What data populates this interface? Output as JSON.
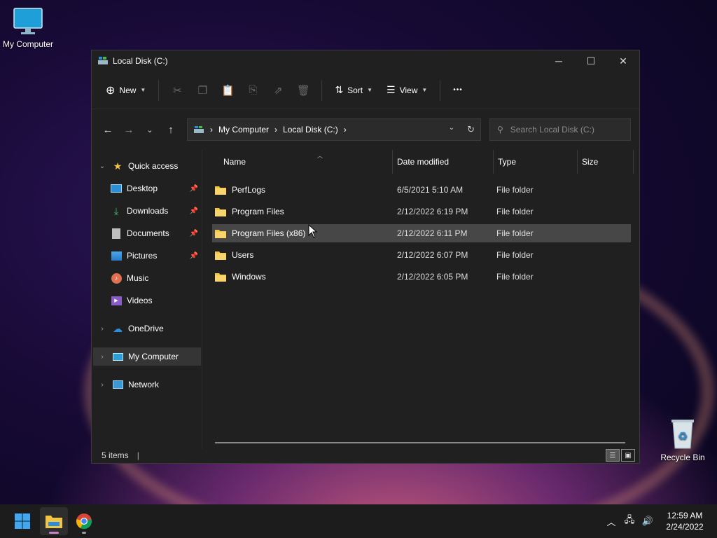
{
  "desktop": {
    "icons": [
      {
        "label": "My Computer"
      },
      {
        "label": "Recycle Bin"
      }
    ]
  },
  "window": {
    "title": "Local Disk (C:)",
    "controls": {
      "minimize": "─",
      "maximize": "☐",
      "close": "✕"
    }
  },
  "toolbar": {
    "new_label": "New",
    "sort_label": "Sort",
    "view_label": "View",
    "more_label": "•••",
    "disabled_icons": [
      "cut-icon",
      "copy-icon",
      "paste-icon",
      "rename-icon",
      "share-icon",
      "delete-icon"
    ]
  },
  "address": {
    "crumbs": [
      "My Computer",
      "Local Disk (C:)"
    ],
    "search_placeholder": "Search Local Disk (C:)"
  },
  "navpane": {
    "quick_access": "Quick access",
    "items": [
      {
        "label": "Desktop",
        "pinned": true
      },
      {
        "label": "Downloads",
        "pinned": true
      },
      {
        "label": "Documents",
        "pinned": true
      },
      {
        "label": "Pictures",
        "pinned": true
      },
      {
        "label": "Music",
        "pinned": false
      },
      {
        "label": "Videos",
        "pinned": false
      }
    ],
    "onedrive": "OneDrive",
    "my_computer": "My Computer",
    "network": "Network"
  },
  "files": {
    "columns": {
      "name": "Name",
      "date": "Date modified",
      "type": "Type",
      "size": "Size"
    },
    "rows": [
      {
        "name": "PerfLogs",
        "date": "6/5/2021 5:10 AM",
        "type": "File folder",
        "selected": false
      },
      {
        "name": "Program Files",
        "date": "2/12/2022 6:19 PM",
        "type": "File folder",
        "selected": false
      },
      {
        "name": "Program Files (x86)",
        "date": "2/12/2022 6:11 PM",
        "type": "File folder",
        "selected": true
      },
      {
        "name": "Users",
        "date": "2/12/2022 6:07 PM",
        "type": "File folder",
        "selected": false
      },
      {
        "name": "Windows",
        "date": "2/12/2022 6:05 PM",
        "type": "File folder",
        "selected": false
      }
    ]
  },
  "status": {
    "items": "5 items"
  },
  "taskbar": {
    "time": "12:59 AM",
    "date": "2/24/2022"
  },
  "colors": {
    "folder": "#f4c542",
    "accent": "#c383c4",
    "window_bg": "#202020"
  }
}
